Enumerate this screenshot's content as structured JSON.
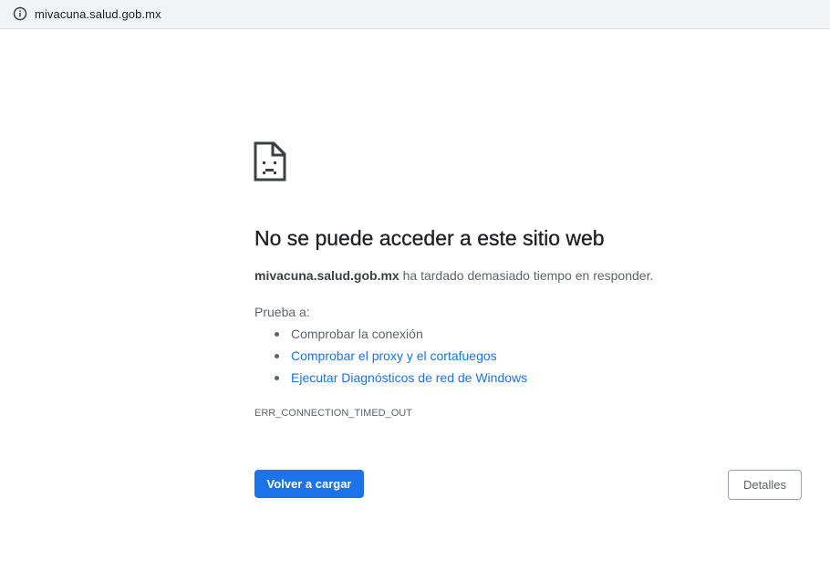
{
  "address_bar": {
    "icon": "info-icon",
    "url": "mivacuna.salud.gob.mx"
  },
  "error_page": {
    "icon": "sad-page-icon",
    "title": "No se puede acceder a este sitio web",
    "summary_host": "mivacuna.salud.gob.mx",
    "summary_text": " ha tardado demasiado tiempo en responder.",
    "try_label": "Prueba a:",
    "suggestions": [
      {
        "label": "Comprobar la conexión",
        "is_link": false
      },
      {
        "label": "Comprobar el proxy y el cortafuegos",
        "is_link": true
      },
      {
        "label": "Ejecutar Diagnósticos de red de Windows",
        "is_link": true
      }
    ],
    "error_code": "ERR_CONNECTION_TIMED_OUT",
    "reload_label": "Volver a cargar",
    "details_label": "Detalles"
  },
  "colors": {
    "accent": "#1a73e8",
    "text_primary": "#202124",
    "text_secondary": "#5f6368",
    "address_bar_bg": "#f1f3f4"
  }
}
